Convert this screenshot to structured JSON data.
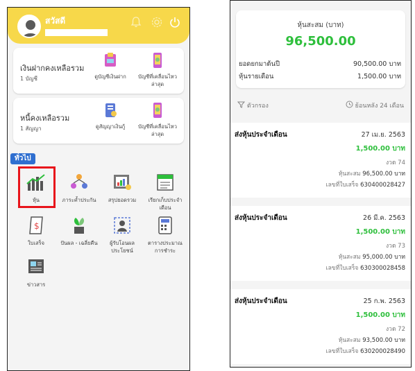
{
  "left": {
    "header": {
      "greeting": "สวัสดี"
    },
    "deposit_card": {
      "title": "เงินฝากคงเหลือรวม",
      "count": "1 บัญชี",
      "action_view": "ดูบัญชีเงินฝาก",
      "action_latest": "บัญชีที่เคลื่อนไหวล่าสุด"
    },
    "loan_card": {
      "title": "หนี้คงเหลือรวม",
      "count": "1 สัญญา",
      "action_view": "ดูสัญญาเงินกู้",
      "action_latest": "บัญชีที่เคลื่อนไหวล่าสุด"
    },
    "section_label": "ทั่วไป",
    "menu": [
      {
        "label": "หุ้น",
        "icon": "stock-chart-icon"
      },
      {
        "label": "ภาระค้ำประกัน",
        "icon": "guarantor-icon"
      },
      {
        "label": "สรุปยอดรวม",
        "icon": "summary-icon"
      },
      {
        "label": "เรียกเก็บประจำเดือน",
        "icon": "monthly-bill-icon"
      },
      {
        "label": "ใบเสร็จ",
        "icon": "receipt-icon"
      },
      {
        "label": "ปันผล - เฉลี่ยคืน",
        "icon": "dividend-icon"
      },
      {
        "label": "ผู้รับโอนผลประโยชน์",
        "icon": "beneficiary-icon"
      },
      {
        "label": "ตารางประมาณการชำระ",
        "icon": "payment-table-icon"
      },
      {
        "label": "ข่าวสาร",
        "icon": "news-icon"
      }
    ]
  },
  "right": {
    "summary": {
      "title": "หุ้นสะสม (บาท)",
      "value": "96,500.00",
      "row1_label": "ยอดยกมาต้นปี",
      "row1_value": "90,500.00 บาท",
      "row2_label": "หุ้นรายเดือน",
      "row2_value": "1,500.00 บาท"
    },
    "filter": {
      "label": "ตัวกรอง",
      "range": "ย้อนหลัง 24 เดือน"
    },
    "transactions": [
      {
        "type": "ส่งหุ้นประจำเดือน",
        "date": "27 เม.ย. 2563",
        "amount": "1,500.00 บาท",
        "installment_label": "งวด",
        "installment": "74",
        "accum_label": "หุ้นสะสม",
        "accum": "96,500.00 บาท",
        "receipt_label": "เลขที่ใบเสร็จ",
        "receipt": "630400028427"
      },
      {
        "type": "ส่งหุ้นประจำเดือน",
        "date": "26 มี.ค. 2563",
        "amount": "1,500.00 บาท",
        "installment_label": "งวด",
        "installment": "73",
        "accum_label": "หุ้นสะสม",
        "accum": "95,000.00 บาท",
        "receipt_label": "เลขที่ใบเสร็จ",
        "receipt": "630300028458"
      },
      {
        "type": "ส่งหุ้นประจำเดือน",
        "date": "25 ก.พ. 2563",
        "amount": "1,500.00 บาท",
        "installment_label": "งวด",
        "installment": "72",
        "accum_label": "หุ้นสะสม",
        "accum": "93,500.00 บาท",
        "receipt_label": "เลขที่ใบเสร็จ",
        "receipt": "630200028490"
      }
    ]
  },
  "colors": {
    "header": "#f7d84a",
    "accent_green": "#2ebf3c",
    "section_blue": "#2f6fd0",
    "highlight_red": "#e8141b"
  }
}
